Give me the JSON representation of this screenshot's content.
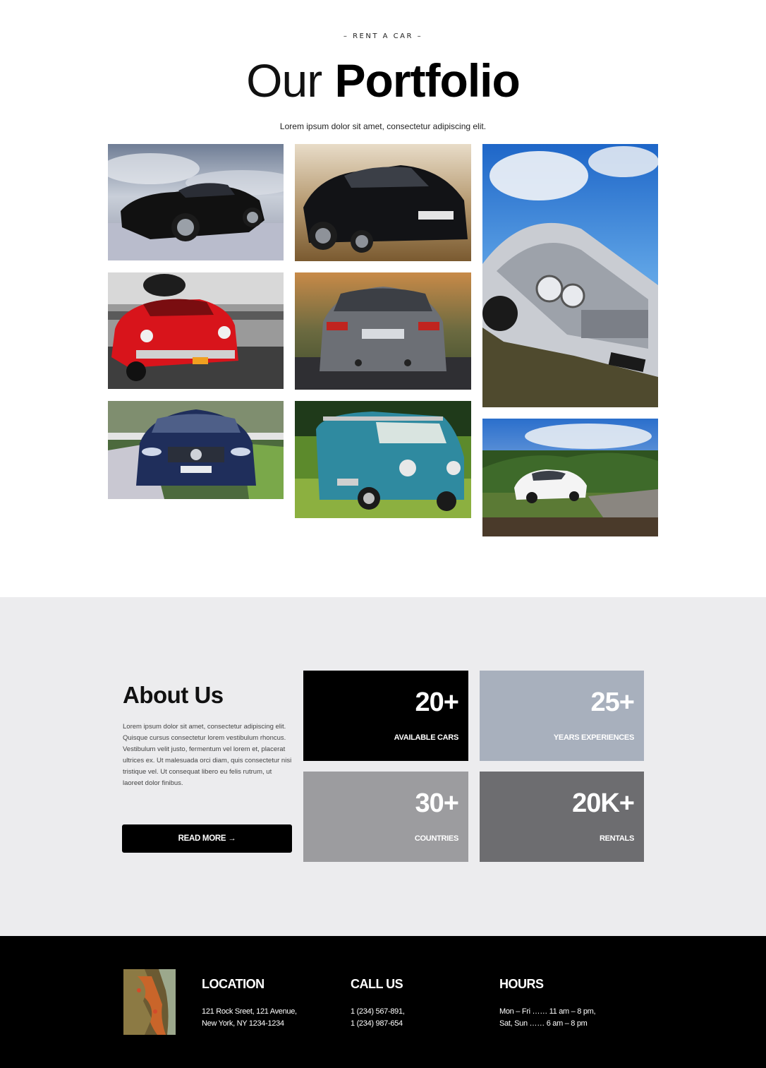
{
  "portfolio": {
    "eyebrow": "– RENT A CAR –",
    "title_light": "Our",
    "title_bold": "Portfolio",
    "lead": "Lorem ipsum dolor sit amet, consectetur adipiscing elit."
  },
  "gallery": [
    {
      "name": "black-mustang-photo"
    },
    {
      "name": "black-audi-photo"
    },
    {
      "name": "vintage-silver-car-photo"
    },
    {
      "name": "red-classic-car-photo"
    },
    {
      "name": "grey-bmw-rear-photo"
    },
    {
      "name": "blue-mercedes-photo"
    },
    {
      "name": "blue-vw-van-photo"
    },
    {
      "name": "white-tesla-photo"
    }
  ],
  "about": {
    "title": "About Us",
    "text": "Lorem ipsum dolor sit amet, consectetur adipiscing elit. Quisque cursus consectetur lorem vestibulum rhoncus. Vestibulum velit justo, fermentum vel lorem et, placerat ultrices ex. Ut malesuada orci diam, quis consectetur nisi tristique vel. Ut consequat libero eu felis rutrum, ut laoreet dolor finibus.",
    "button": "READ MORE →",
    "stats": [
      {
        "value": "20+",
        "label": "AVAILABLE CARS",
        "color": "#000000"
      },
      {
        "value": "25+",
        "label": "YEARS EXPERIENCES",
        "color": "#a8b0bd"
      },
      {
        "value": "30+",
        "label": "COUNTRIES",
        "color": "#9c9c9f"
      },
      {
        "value": "20K+",
        "label": "RENTALS",
        "color": "#6d6d70"
      }
    ]
  },
  "footer": {
    "location": {
      "title": "LOCATION",
      "line1": "121 Rock Sreet, 121 Avenue,",
      "line2": "New York, NY 1234-1234"
    },
    "call": {
      "title": "CALL US",
      "line1": "1 (234) 567-891,",
      "line2": "1 (234) 987-654"
    },
    "hours": {
      "title": "HOURS",
      "line1": "Mon – Fri …… 11 am – 8 pm,",
      "line2": "Sat, Sun …… 6 am – 8 pm"
    }
  }
}
